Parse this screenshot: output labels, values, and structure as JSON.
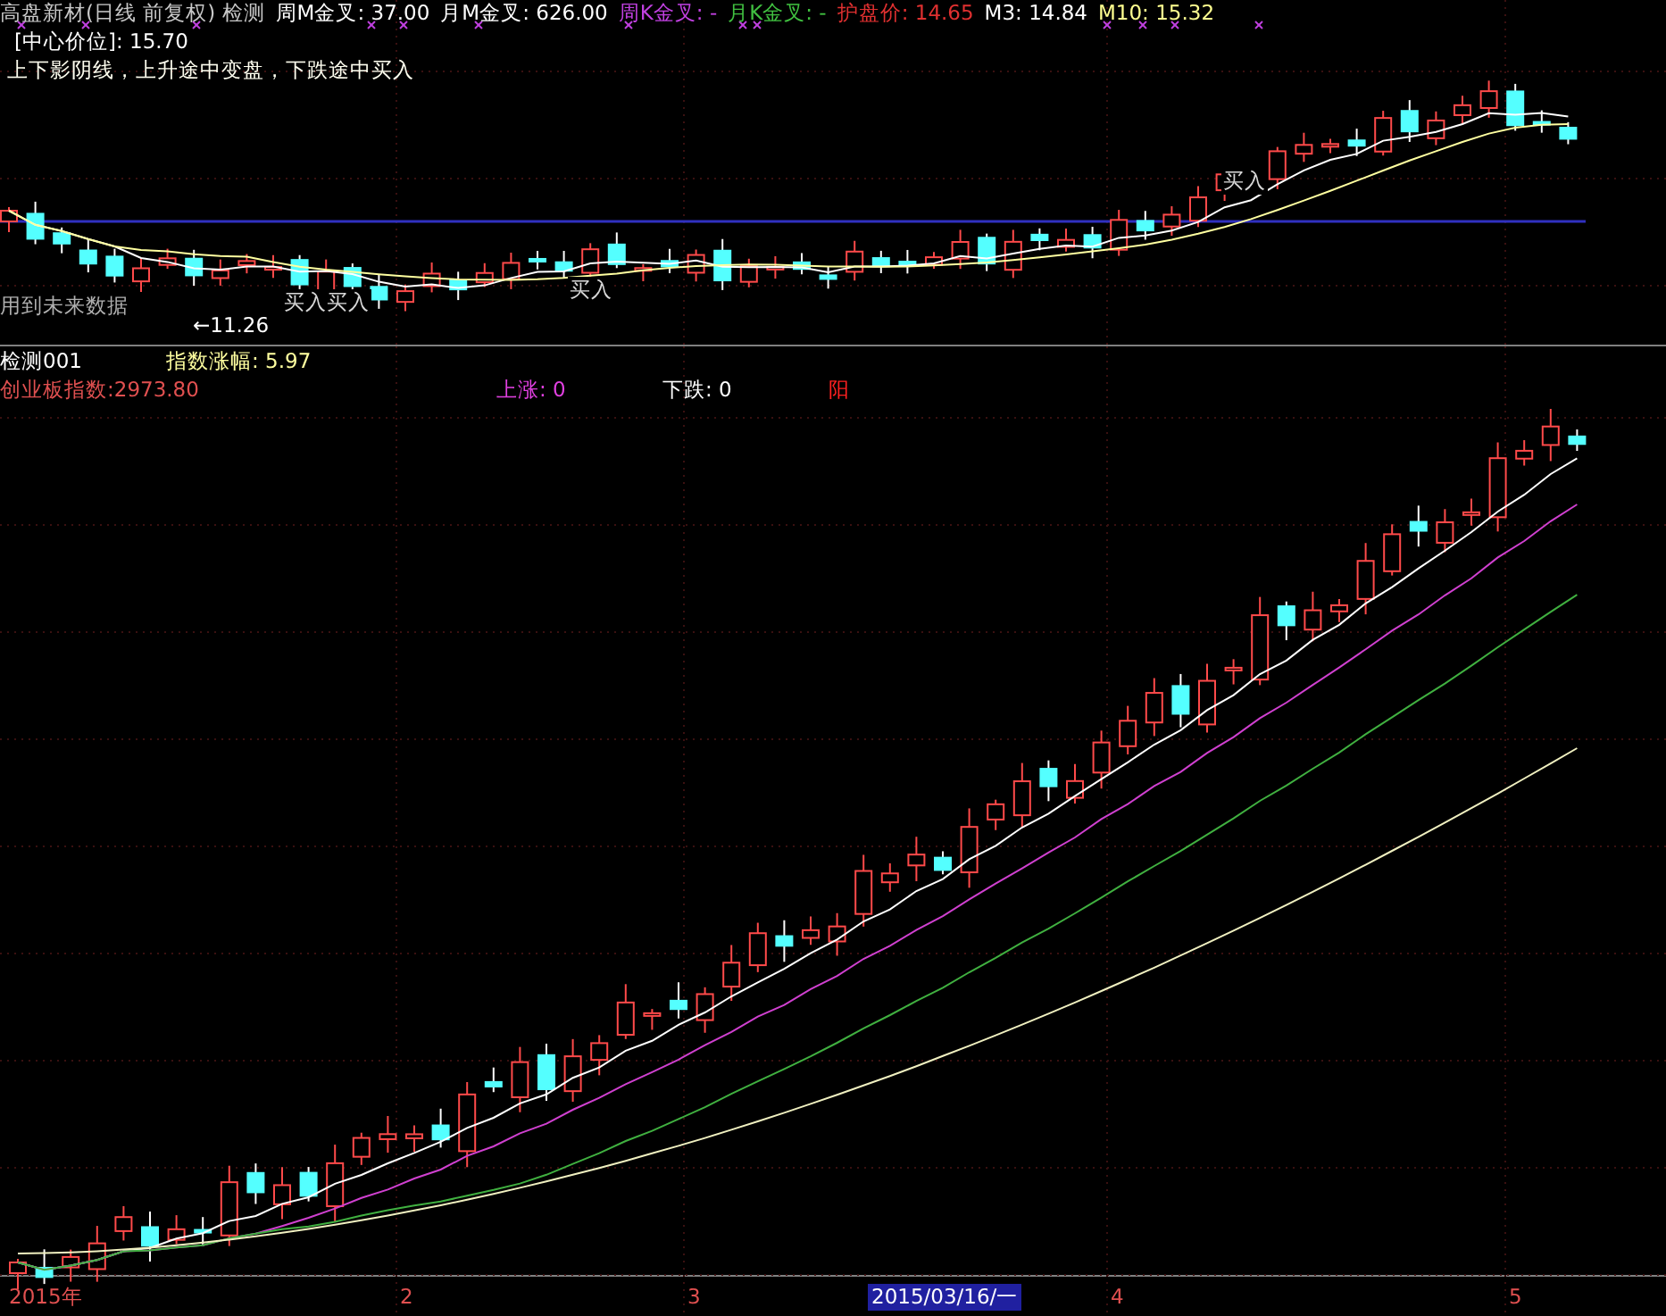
{
  "title_bar": {
    "items": [
      {
        "text": "高盘新材(日线 前复权) 检测",
        "color": "#c8c8c8"
      },
      {
        "text": "周M金叉: 37.00",
        "color": "#ffffff"
      },
      {
        "text": "月M金叉: 626.00",
        "color": "#ffffff"
      },
      {
        "text": "周K金叉: -",
        "color": "#c040e0"
      },
      {
        "text": "月K金叉: -",
        "color": "#40c040"
      },
      {
        "text": "护盘价: 14.65",
        "color": "#e03030"
      },
      {
        "text": "M3: 14.84",
        "color": "#ffffff"
      },
      {
        "text": "M10: 15.32",
        "color": "#ffff90"
      }
    ]
  },
  "top_chart": {
    "center_price": "[中心价位]: 15.70",
    "rule_text": "上下影阴线，上升途中变盘，下跌途中买入",
    "annotations": [
      {
        "kind": "note",
        "text": "用到未来数据"
      },
      {
        "kind": "low",
        "text": "←11.26"
      },
      {
        "kind": "signal",
        "text": "买入买入"
      },
      {
        "kind": "signal",
        "text": "买入"
      },
      {
        "kind": "signal",
        "text": "买入"
      }
    ]
  },
  "lower_chart": {
    "name": "检测001",
    "change": "指数涨幅: 5.97",
    "stats": [
      {
        "text": "创业板指数:2973.80",
        "color": "#e05050"
      },
      {
        "text": "上涨: 0",
        "color": "#e040e0"
      },
      {
        "text": "下跌: 0",
        "color": "#ffffff"
      },
      {
        "text": "阳",
        "color": "#ff2020"
      }
    ]
  },
  "time_axis": {
    "labels": [
      {
        "text": "2015年",
        "selected": false
      },
      {
        "text": "2",
        "selected": false
      },
      {
        "text": "3",
        "selected": false
      },
      {
        "text": "2015/03/16/一",
        "selected": true
      },
      {
        "text": "4",
        "selected": false
      },
      {
        "text": "5",
        "selected": false
      }
    ]
  }
}
